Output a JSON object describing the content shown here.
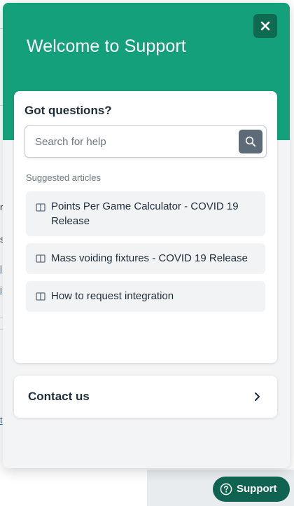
{
  "background": {
    "fragments": [
      "r",
      "s",
      "l",
      "i",
      "t"
    ]
  },
  "widget": {
    "title": "Welcome to Support",
    "close_icon": "close-icon",
    "accent_color": "#14a07a",
    "search_card": {
      "heading": "Got questions?",
      "search_placeholder": "Search for help",
      "search_value": "",
      "search_icon": "search-icon",
      "suggested_label": "Suggested articles",
      "articles": [
        {
          "icon": "book-icon",
          "title": "Points Per Game Calculator - COVID 19 Release"
        },
        {
          "icon": "book-icon",
          "title": "Mass voiding fixtures - COVID 19 Release"
        },
        {
          "icon": "book-icon",
          "title": "How to request integration"
        }
      ]
    },
    "contact": {
      "label": "Contact us",
      "icon": "chevron-right-icon"
    }
  },
  "launcher": {
    "label": "Support",
    "icon": "help-circle-icon",
    "color": "#0f6350"
  }
}
